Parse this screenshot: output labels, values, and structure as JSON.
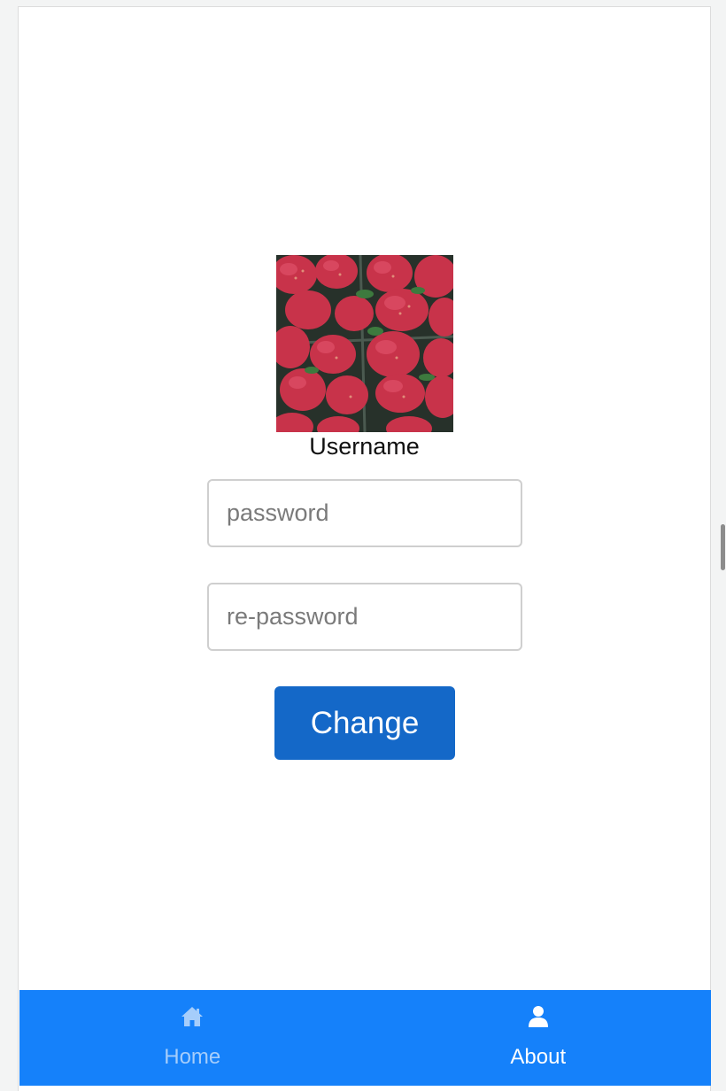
{
  "profile": {
    "username": "Username",
    "avatar": "strawberries-photo"
  },
  "form": {
    "password_placeholder": "password",
    "repassword_placeholder": "re-password",
    "change_label": "Change"
  },
  "tabs": [
    {
      "label": "Home",
      "icon": "home-icon",
      "active": false
    },
    {
      "label": "About",
      "icon": "user-icon",
      "active": true
    }
  ],
  "colors": {
    "tabbar": "#1581fa",
    "button": "#1468c8",
    "tab_inactive": "#a5cdfb",
    "tab_active": "#ffffff"
  }
}
